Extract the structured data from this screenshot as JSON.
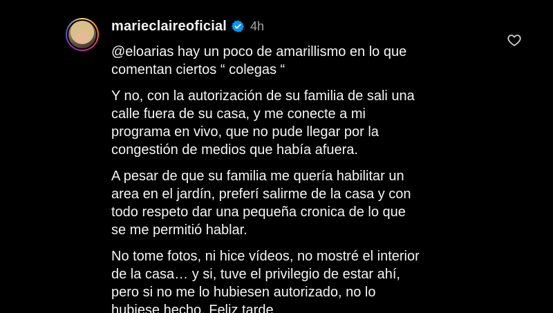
{
  "comment": {
    "username": "marieclaireoficial",
    "verified": true,
    "time": "4h",
    "paragraphs": [
      "@eloarias hay un poco de amarillismo en lo que\ncomentan ciertos “ colegas “",
      "Y no, con la autorización de su familia de sali una\ncalle fuera de su casa, y me conecte a mi\nprograma en vivo, que no pude llegar por la\ncongestión de medios que había afuera.",
      "A pesar de que su familia me quería habilitar un\narea en el jardín, preferí salirme de la casa y con\ntodo respeto dar una pequeña cronica de lo que\nse me permitió hablar.",
      "No tome fotos, ni hice vídeos, no mostré el interior\nde la casa… y si, tuve el privilegio de estar ahí,\npero si no me lo hubiesen autorizado, no lo\nhubiese hecho. Feliz tarde"
    ]
  },
  "icons": {
    "verified": "verified-badge-icon",
    "like": "heart-icon"
  },
  "colors": {
    "background": "#000000",
    "text": "#f5f5f5",
    "muted": "#a8a8a8",
    "verified_blue": "#0095f6"
  }
}
